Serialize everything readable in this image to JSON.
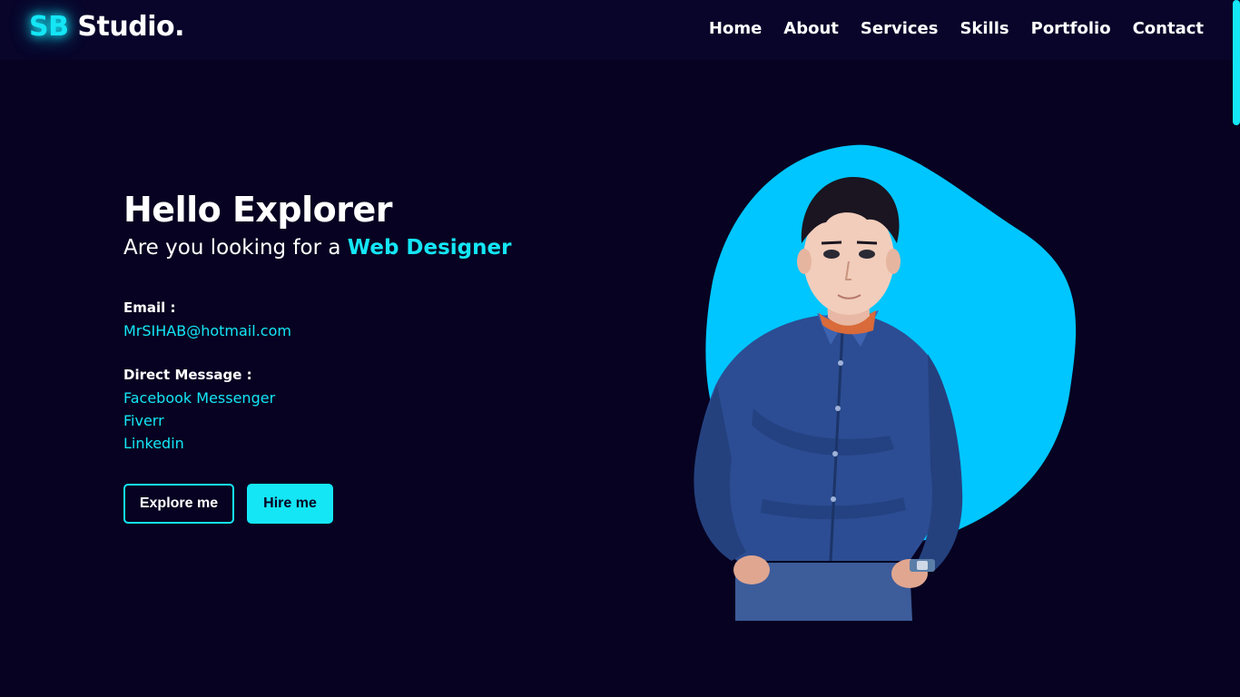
{
  "header": {
    "logo_accent": "SB",
    "logo_rest": " Studio.",
    "nav": [
      "Home",
      "About",
      "Services",
      "Skills",
      "Portfolio",
      "Contact"
    ]
  },
  "hero": {
    "heading": "Hello Explorer",
    "subtitle_prefix": "Are you looking for a ",
    "subtitle_highlight": "Web Designer",
    "email_label": "Email :",
    "email_value": "MrSIHAB@hotmail.com",
    "dm_label": "Direct Message :",
    "dm_links": [
      "Facebook Messenger",
      "Fiverr",
      "Linkedin"
    ],
    "explore_label": "Explore me",
    "hire_label": "Hire me"
  },
  "illustration": {
    "subject": "person-in-blue-shirt-avatar",
    "blob_color": "#00c6ff"
  },
  "colors": {
    "background": "#070221",
    "accent": "#14e6f5",
    "text": "#ffffff"
  }
}
